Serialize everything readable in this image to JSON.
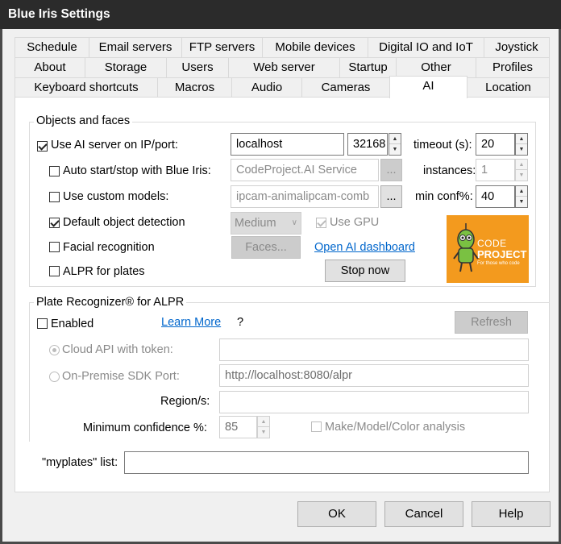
{
  "window": {
    "title": "Blue Iris Settings"
  },
  "tabs": {
    "row1": [
      "Schedule",
      "Email servers",
      "FTP servers",
      "Mobile devices",
      "Digital IO and IoT",
      "Joystick"
    ],
    "row2": [
      "About",
      "Storage",
      "Users",
      "Web server",
      "Startup",
      "Other",
      "Profiles"
    ],
    "row3": [
      "Keyboard shortcuts",
      "Macros",
      "Audio",
      "Cameras",
      "AI",
      "Location"
    ],
    "active": "AI"
  },
  "objects": {
    "legend": "Objects and faces",
    "use_ai_server": {
      "label": "Use AI server on IP/port:",
      "checked": true
    },
    "host": "localhost",
    "port": "32168",
    "timeout_label": "timeout (s):",
    "timeout": "20",
    "auto_start": {
      "label": "Auto start/stop with Blue Iris:",
      "checked": false
    },
    "service": "CodeProject.AI Service",
    "browse1": "...",
    "instances_label": "instances:",
    "instances": "1",
    "custom_models": {
      "label": "Use custom models:",
      "checked": false
    },
    "models": "ipcam-animalipcam-comb",
    "browse2": "...",
    "minconf_label": "min conf%:",
    "minconf": "40",
    "default_detection": {
      "label": "Default object detection",
      "checked": true
    },
    "detection_mode": "Medium",
    "use_gpu": {
      "label": "Use GPU",
      "checked": true
    },
    "facial": {
      "label": "Facial recognition",
      "checked": false
    },
    "faces_button": "Faces...",
    "dashboard_link": "Open AI dashboard",
    "alpr": {
      "label": "ALPR for plates",
      "checked": false
    },
    "stop_button": "Stop now",
    "logo": {
      "line1": "CODE",
      "line2": "PROJECT",
      "tagline": "For those who code",
      "bg": "#f39a1e"
    }
  },
  "plates": {
    "legend": "Plate Recognizer® for ALPR",
    "enabled": {
      "label": "Enabled",
      "checked": false
    },
    "learn_more": "Learn More",
    "help_mark": "?",
    "refresh_button": "Refresh",
    "cloud": {
      "label": "Cloud API with token:",
      "selected": true
    },
    "token": "",
    "onprem": {
      "label": "On-Premise SDK Port:",
      "selected": false
    },
    "onprem_url": "http://localhost:8080/alpr",
    "region_label": "Region/s:",
    "region": "",
    "min_conf_label": "Minimum confidence %:",
    "min_conf": "85",
    "mmc": {
      "label": "Make/Model/Color analysis",
      "checked": false
    }
  },
  "myplates": {
    "label": "\"myplates\" list:",
    "value": ""
  },
  "footer": {
    "ok": "OK",
    "cancel": "Cancel",
    "help": "Help"
  }
}
